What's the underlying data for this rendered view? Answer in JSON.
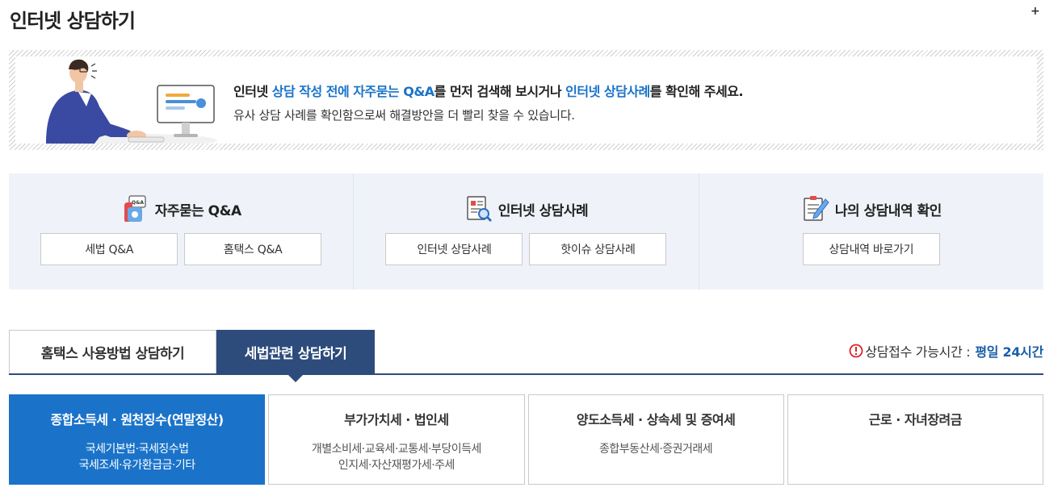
{
  "header": {
    "title": "인터넷 상담하기",
    "plus": "+"
  },
  "banner": {
    "l1_a": "인터넷 ",
    "l1_b": "상담 작성 전에 자주묻는 Q&A",
    "l1_c": "를 먼저 검색해 보시거나 ",
    "l1_d": "인터넷 상담사례",
    "l1_e": "를 확인해 주세요.",
    "line2": "유사 상담 사례를 확인함으로써 해결방안을 더 빨리 찾을 수 있습니다."
  },
  "quick": {
    "faq": {
      "title": "자주묻는 Q&A",
      "buttons": [
        "세법 Q&A",
        "홈택스 Q&A"
      ]
    },
    "cases": {
      "title": "인터넷 상담사례",
      "buttons": [
        "인터넷 상담사례",
        "핫이슈 상담사례"
      ]
    },
    "mine": {
      "title": "나의 상담내역 확인",
      "buttons": [
        "상담내역 바로가기"
      ]
    }
  },
  "tabs": {
    "items": [
      "홈택스 사용방법 상담하기",
      "세법관련 상담하기"
    ],
    "active": 1,
    "hours_label": "상담접수 가능시간 : ",
    "hours_value": "평일 24시간"
  },
  "categories": [
    {
      "title": "종합소득세 · 원천징수(연말정산)",
      "sub1": "국세기본법·국세징수법",
      "sub2": "국세조세·유가환급금·기타",
      "active": true
    },
    {
      "title": "부가가치세 · 법인세",
      "sub1": "개별소비세·교육세·교통세·부당이득세",
      "sub2": "인지세·자산재평가세·주세",
      "active": false
    },
    {
      "title": "양도소득세 · 상속세 및 증여세",
      "sub1": "종합부동산세·증권거래세",
      "sub2": "",
      "active": false
    },
    {
      "title": "근로 · 자녀장려금",
      "sub1": "",
      "sub2": "",
      "active": false
    }
  ],
  "colors": {
    "accent_blue": "#1a73c9",
    "tab_navy": "#2d4c7c",
    "panel_bg": "#eff3f9",
    "warning_red": "#d9262b"
  }
}
